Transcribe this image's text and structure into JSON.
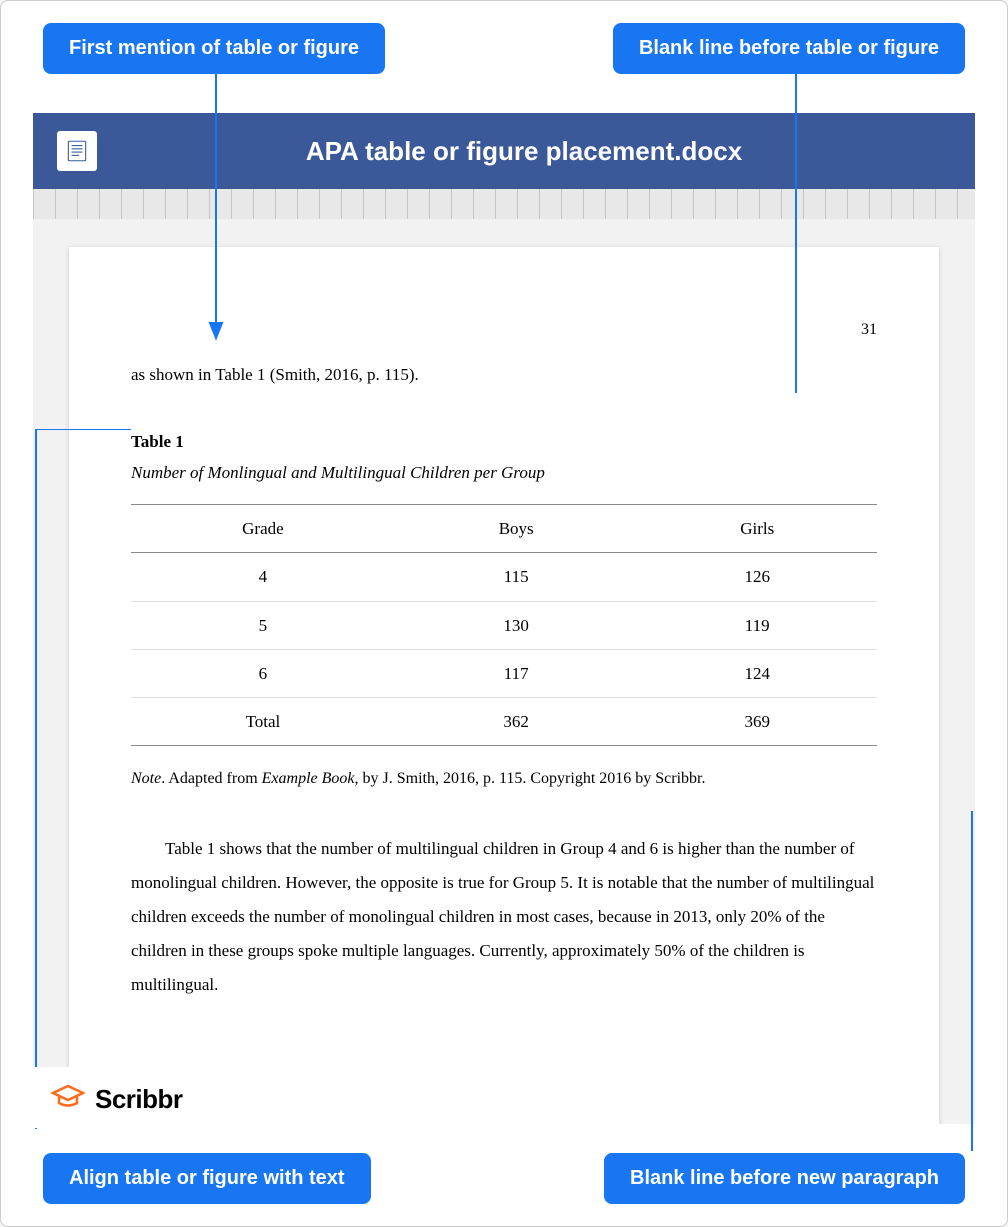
{
  "callouts": {
    "topLeft": "First mention of table or figure",
    "topRight": "Blank line before table or figure",
    "bottomLeft": "Align table or figure with text",
    "bottomRight": "Blank line before new paragraph"
  },
  "wordTitle": "APA table or figure placement.docx",
  "pageNumber": "31",
  "introText": "as shown in Table 1 (Smith, 2016, p. 115).",
  "tableNumber": "Table 1",
  "tableTitle": "Number of Monlingual and Multilingual Children per Group",
  "table": {
    "headers": [
      "Grade",
      "Boys",
      "Girls"
    ],
    "rows": [
      [
        "4",
        "115",
        "126"
      ],
      [
        "5",
        "130",
        "119"
      ],
      [
        "6",
        "117",
        "124"
      ]
    ],
    "total": [
      "Total",
      "362",
      "369"
    ]
  },
  "noteLabel": "Note",
  "notePrefix": ". Adapted from ",
  "noteBook": "Example Book",
  "noteRest": ", by J. Smith, 2016, p. 115. Copyright 2016 by Scribbr.",
  "paragraph": "Table 1 shows that the number of multilingual children in Group 4 and 6 is higher than the number of monolingual children. However, the opposite is true for Group 5. It is notable that the number of multilingual children exceeds the number of monolingual children in most cases, because in 2013, only 20% of the children in these groups spoke multiple languages. Currently, approximately 50% of the children is multilingual.",
  "logoText": "Scribbr"
}
